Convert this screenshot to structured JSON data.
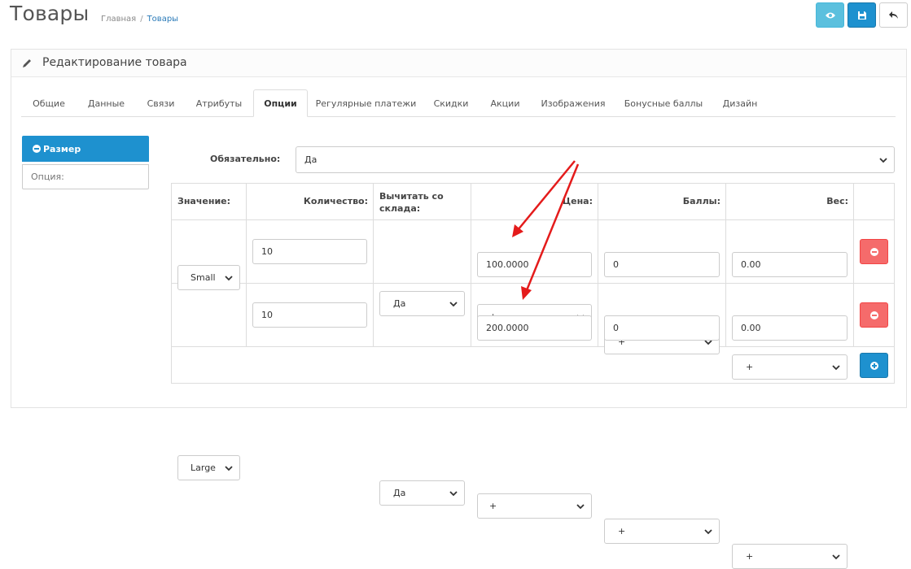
{
  "header": {
    "title": "Товары",
    "breadcrumb": [
      "Главная",
      "Товары"
    ],
    "buttons": {
      "preview_icon": "eye-icon",
      "save_icon": "save-icon",
      "back_icon": "reply-icon"
    },
    "colors": {
      "info": "#5bc0de",
      "primary": "#1e91cf",
      "danger": "#f56b6b"
    }
  },
  "panel": {
    "title": "Редактирование товара",
    "tabs": [
      "Общие",
      "Данные",
      "Связи",
      "Атрибуты",
      "Опции",
      "Регулярные платежи",
      "Скидки",
      "Акции",
      "Изображения",
      "Бонусные баллы",
      "Дизайн"
    ],
    "active_tab": "Опции"
  },
  "options": {
    "selected_option": "Размер",
    "option_input_placeholder": "Опция:",
    "required_label": "Обязательно:",
    "required_value": "Да"
  },
  "table": {
    "headers": {
      "value": "Значение:",
      "quantity": "Количество:",
      "subtract": "Вычитать со склада:",
      "price": "Цена:",
      "points": "Баллы:",
      "weight": "Вес:"
    },
    "rows": [
      {
        "value": "Small",
        "quantity": "10",
        "subtract": "Да",
        "price_prefix": "+",
        "price": "100.0000",
        "points_prefix": "+",
        "points": "0",
        "weight_prefix": "+",
        "weight": "0.00"
      },
      {
        "value": "Large",
        "quantity": "10",
        "subtract": "Да",
        "price_prefix": "+",
        "price": "200.0000",
        "points_prefix": "+",
        "points": "0",
        "weight_prefix": "+",
        "weight": "0.00"
      }
    ]
  }
}
